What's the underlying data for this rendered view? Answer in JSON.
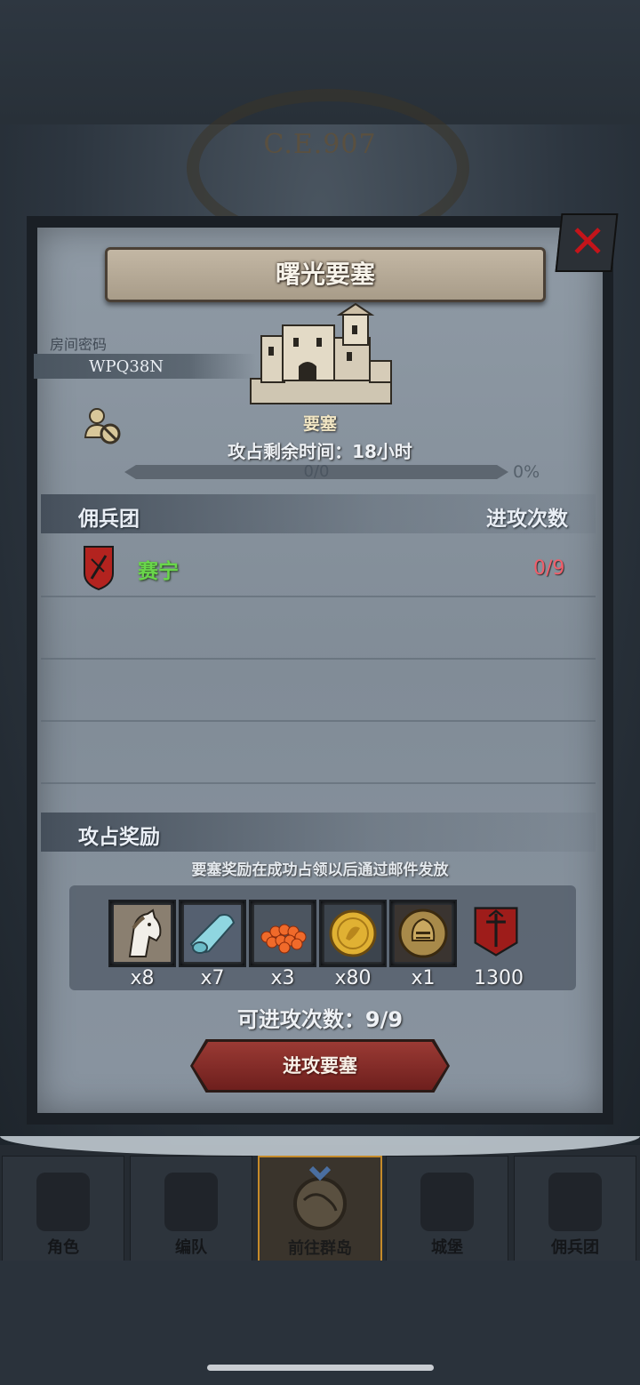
{
  "header": {
    "era": "C.E.907"
  },
  "dialog": {
    "title": "曙光要塞",
    "close_symbol": "✕",
    "room_password_label": "房间密码",
    "room_password": "WPQ38N",
    "building_name": "要塞",
    "time_remaining": "攻占剩余时间：18小时",
    "progress_text": "0/0",
    "progress_percent": "0%",
    "progress_value": 0,
    "mercenary_header": "佣兵团",
    "attack_count_header": "进攻次数",
    "mercenaries": [
      {
        "name": "赛宁",
        "attacks": "0/9"
      }
    ],
    "rewards_header": "攻占奖励",
    "rewards_note": "要塞奖励在成功占领以后通过邮件发放",
    "rewards": [
      {
        "icon": "horse-icon",
        "count": "x8"
      },
      {
        "icon": "cloth-roll-icon",
        "count": "x7"
      },
      {
        "icon": "berries-icon",
        "count": "x3"
      },
      {
        "icon": "gold-coin-icon",
        "count": "x80"
      },
      {
        "icon": "helmet-icon",
        "count": "x1"
      },
      {
        "icon": "banner-icon",
        "count": "1300"
      }
    ],
    "attacks_available": "可进攻次数：9/9",
    "attack_button": "进攻要塞"
  },
  "bottom_nav": [
    {
      "label": "角色",
      "active": false
    },
    {
      "label": "编队",
      "active": false
    },
    {
      "label": "前往群岛",
      "active": true
    },
    {
      "label": "城堡",
      "active": false
    },
    {
      "label": "佣兵团",
      "active": false
    }
  ],
  "colors": {
    "merc_name": "#69d64a",
    "merc_count": "#f05e6a",
    "close": "#c4141a",
    "active_tab_border": "#c58a2a"
  }
}
